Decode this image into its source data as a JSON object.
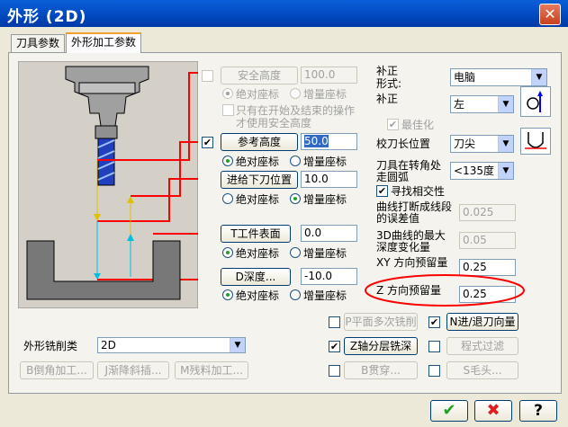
{
  "window": {
    "title": "外形  (2D)",
    "close_glyph": "✕"
  },
  "tabs": [
    {
      "label": "刀具参数"
    },
    {
      "label": "外形加工参数"
    }
  ],
  "safe_height": {
    "button": "安全高度",
    "value": "100.0",
    "abs_label": "绝对座标",
    "inc_label": "增量座标",
    "note_line1": "只有在开始及结束的操作",
    "note_line2": "才使用安全高度"
  },
  "ref_height": {
    "button": "参考高度",
    "value": "50.0",
    "abs_label": "绝对座标",
    "inc_label": "增量座标"
  },
  "feed_plane": {
    "button": "进给下刀位置",
    "value": "10.0",
    "abs_label": "绝对座标",
    "inc_label": "增量座标"
  },
  "top_stock": {
    "button": "T工件表面",
    "value": "0.0",
    "abs_label": "绝对座标",
    "inc_label": "增量座标"
  },
  "depth": {
    "button": "D深度...",
    "value": "-10.0",
    "abs_label": "绝对座标",
    "inc_label": "增量座标"
  },
  "comp": {
    "type_label_1": "补正",
    "type_label_2": "形式:",
    "type_value": "电脑",
    "dir_label": "补正",
    "dir_value": "左",
    "optimize_label": "最佳化",
    "tip_label": "校刀长位置",
    "tip_value": "刀尖",
    "corner_label_1": "刀具在转角处",
    "corner_label_2": "走圆弧",
    "corner_value": "<135度",
    "find_intersect_label": "寻找相交性",
    "tol_label_1": "曲线打断成线段",
    "tol_label_2": "的误差值",
    "tol_value": "0.025",
    "max_depth_label_1": "3D曲线的最大",
    "max_depth_label_2": "深度变化量",
    "max_depth_value": "0.05",
    "xy_stock_label": "XY 方向预留量",
    "xy_stock_value": "0.25",
    "z_stock_label": "Z 方向预留量",
    "z_stock_value": "0.25"
  },
  "bottom": {
    "multi_pass": "P平面多次铣削",
    "lead_inout": "N进/退刀向量",
    "depth_cuts": "Z轴分层铣深",
    "filter": "程式过滤",
    "break_through": "B贯穿...",
    "tabs": "S毛头...",
    "contour_type_label": "外形铣削类",
    "contour_type_value": "2D",
    "chamfer": "B倒角加工...",
    "ramp": "J渐降斜插...",
    "remachining": "M残料加工..."
  },
  "dialog_buttons": {
    "ok": "✔",
    "cancel": "✖",
    "help": "?"
  },
  "colors": {
    "title_bar": "#0450c8",
    "accent_red": "#ff0000",
    "highlight": "#316ac5"
  }
}
